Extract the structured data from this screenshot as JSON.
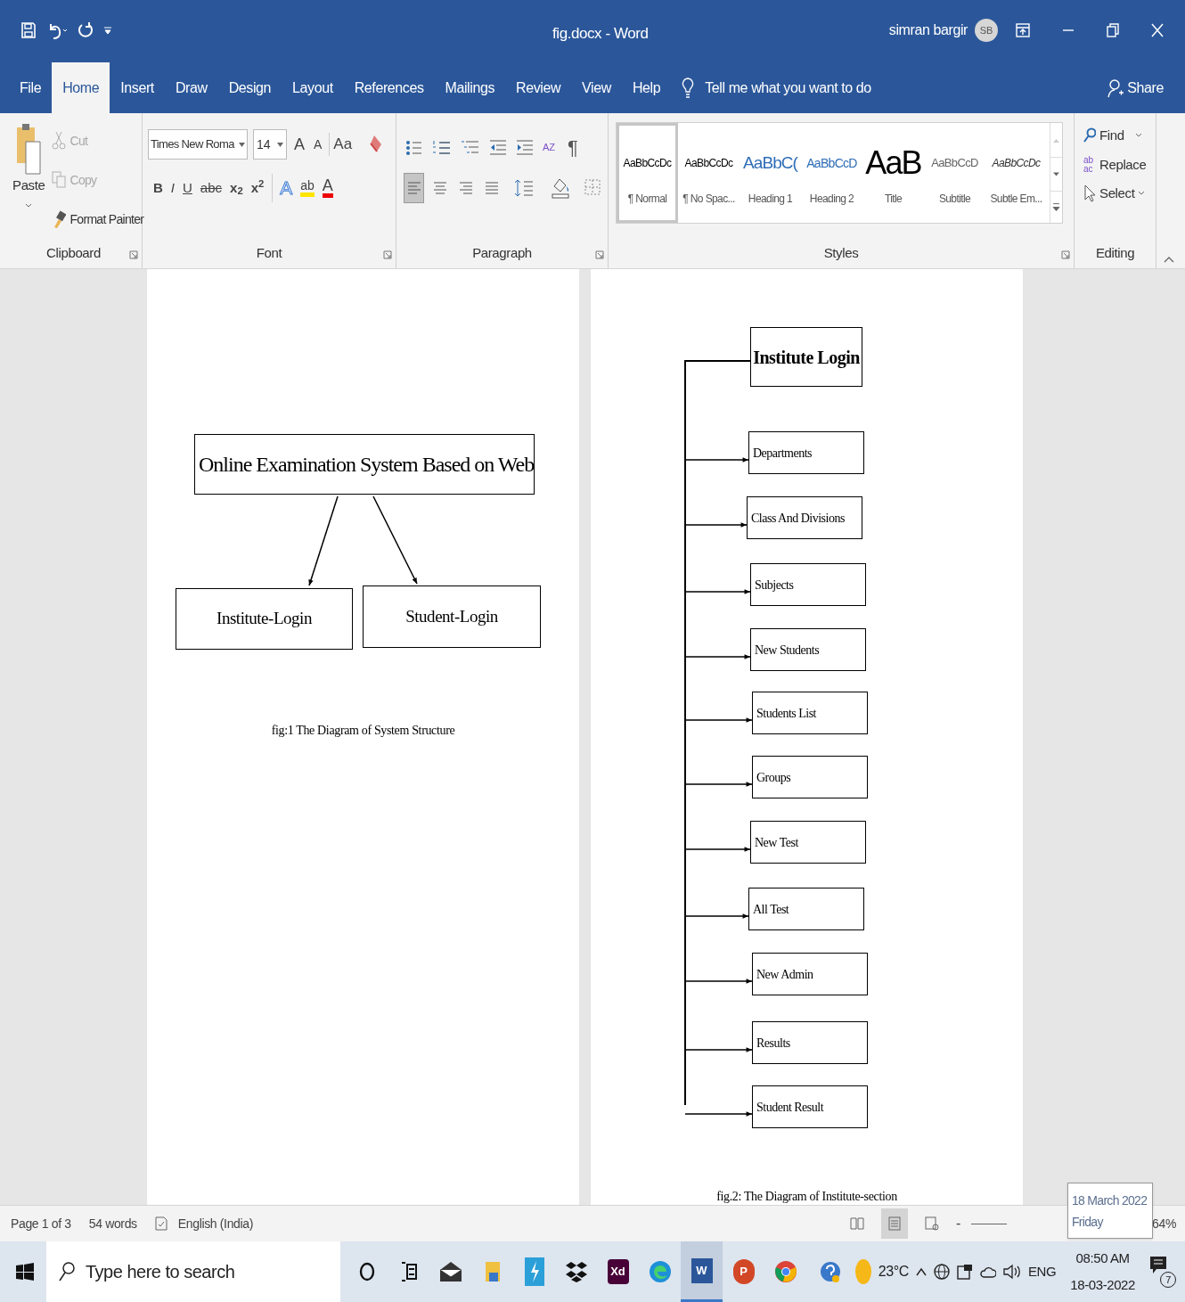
{
  "title_bar": {
    "title": "fig.docx - Word",
    "user": "simran bargir",
    "avatar": "SB"
  },
  "tabs": [
    {
      "label": "File",
      "selected": false
    },
    {
      "label": "Home",
      "selected": true
    },
    {
      "label": "Insert",
      "selected": false
    },
    {
      "label": "Draw",
      "selected": false
    },
    {
      "label": "Design",
      "selected": false
    },
    {
      "label": "Layout",
      "selected": false
    },
    {
      "label": "References",
      "selected": false
    },
    {
      "label": "Mailings",
      "selected": false
    },
    {
      "label": "Review",
      "selected": false
    },
    {
      "label": "View",
      "selected": false
    },
    {
      "label": "Help",
      "selected": false
    }
  ],
  "tell_me": "Tell me what you want to do",
  "share": "Share",
  "clipboard": {
    "label": "Clipboard",
    "paste": "Paste",
    "actions": [
      {
        "kind": "cut",
        "label": "Cut",
        "disabled": true
      },
      {
        "kind": "copy",
        "label": "Copy",
        "disabled": true
      },
      {
        "kind": "painter",
        "label": "Format Painter",
        "disabled": false
      }
    ]
  },
  "font": {
    "label": "Font",
    "font_name": "Times New Roma",
    "size": "14",
    "grow": "A",
    "shrink": "A",
    "change_case": "Aa",
    "format_buttons": [
      "B",
      "I",
      "U",
      "abc",
      "x$_{2}$",
      "x$^{2}$"
    ],
    "effects": "A",
    "highlight": "ab",
    "font_color_glyph": "A"
  },
  "paragraph": {
    "label": "Paragraph",
    "sort": "AZ",
    "marks": "¶",
    "alignments": [
      {
        "kind": "left",
        "selected": true
      },
      {
        "kind": "center",
        "selected": false
      },
      {
        "kind": "right",
        "selected": false
      },
      {
        "kind": "justify",
        "selected": false
      }
    ]
  },
  "styles": {
    "label": "Styles",
    "items": [
      {
        "kind": "normal",
        "preview": "AaBbCcDc",
        "name": "¶ Normal",
        "selected": true
      },
      {
        "kind": "nospacing",
        "preview": "AaBbCcDc",
        "name": "¶ No Spac...",
        "selected": false
      },
      {
        "kind": "heading1",
        "preview": "AaBbC(",
        "name": "Heading 1",
        "selected": false
      },
      {
        "kind": "heading2",
        "preview": "AaBbCcD",
        "name": "Heading 2",
        "selected": false
      },
      {
        "kind": "title",
        "preview": "AaB",
        "name": "Title",
        "selected": false
      },
      {
        "kind": "subtitle",
        "preview": "AaBbCcD",
        "name": "Subtitle",
        "selected": false
      },
      {
        "kind": "emphasis",
        "preview": "AaBbCcDc",
        "name": "Subtle Em...",
        "selected": false
      }
    ]
  },
  "editing": {
    "label": "Editing",
    "find": "Find",
    "replace": "Replace",
    "replace_glyph": "ab ac",
    "select": "Select"
  },
  "page_1": {
    "title": "Online Examination System Based on Web",
    "children": [
      "Institute-Login",
      "Student-Login"
    ],
    "caption": "fig:1 The Diagram of System Structure"
  },
  "page_2": {
    "root": "Institute Login",
    "items": [
      "Departments",
      "Class And Divisions",
      "Subjects",
      "New Students",
      "Students List",
      "Groups",
      "New Test",
      "All Test",
      "New Admin",
      "Results",
      "Student Result"
    ],
    "caption": "fig.2: The Diagram of Institute-section"
  },
  "status_bar": {
    "page": "Page 1 of 3",
    "words": "54 words",
    "language": "English (India)",
    "zoom_out": "-",
    "zoom": "64%",
    "views": [
      {
        "kind": "read",
        "selected": false
      },
      {
        "kind": "print",
        "selected": true
      },
      {
        "kind": "web",
        "selected": false
      }
    ]
  },
  "date_tooltip": {
    "date": "18 March 2022",
    "day": "Friday"
  },
  "taskbar": {
    "search": {
      "placeholder": "Type here to search"
    },
    "apps": [
      {
        "kind": "cortana",
        "selected": false
      },
      {
        "kind": "taskview",
        "selected": false
      },
      {
        "kind": "mail",
        "selected": false
      },
      {
        "kind": "files",
        "selected": false
      },
      {
        "kind": "bolt",
        "selected": false
      },
      {
        "kind": "dropbox",
        "selected": false
      },
      {
        "kind": "xd",
        "glyph": "Xd",
        "selected": false
      },
      {
        "kind": "edge",
        "selected": false
      },
      {
        "kind": "word",
        "glyph": "W",
        "selected": true
      },
      {
        "kind": "powerpoint",
        "glyph": "P",
        "selected": false
      },
      {
        "kind": "chrome",
        "selected": false
      }
    ],
    "temperature": "23°C",
    "language": "ENG",
    "time": "08:50 AM",
    "date": "18-03-2022",
    "notifications": "7"
  }
}
